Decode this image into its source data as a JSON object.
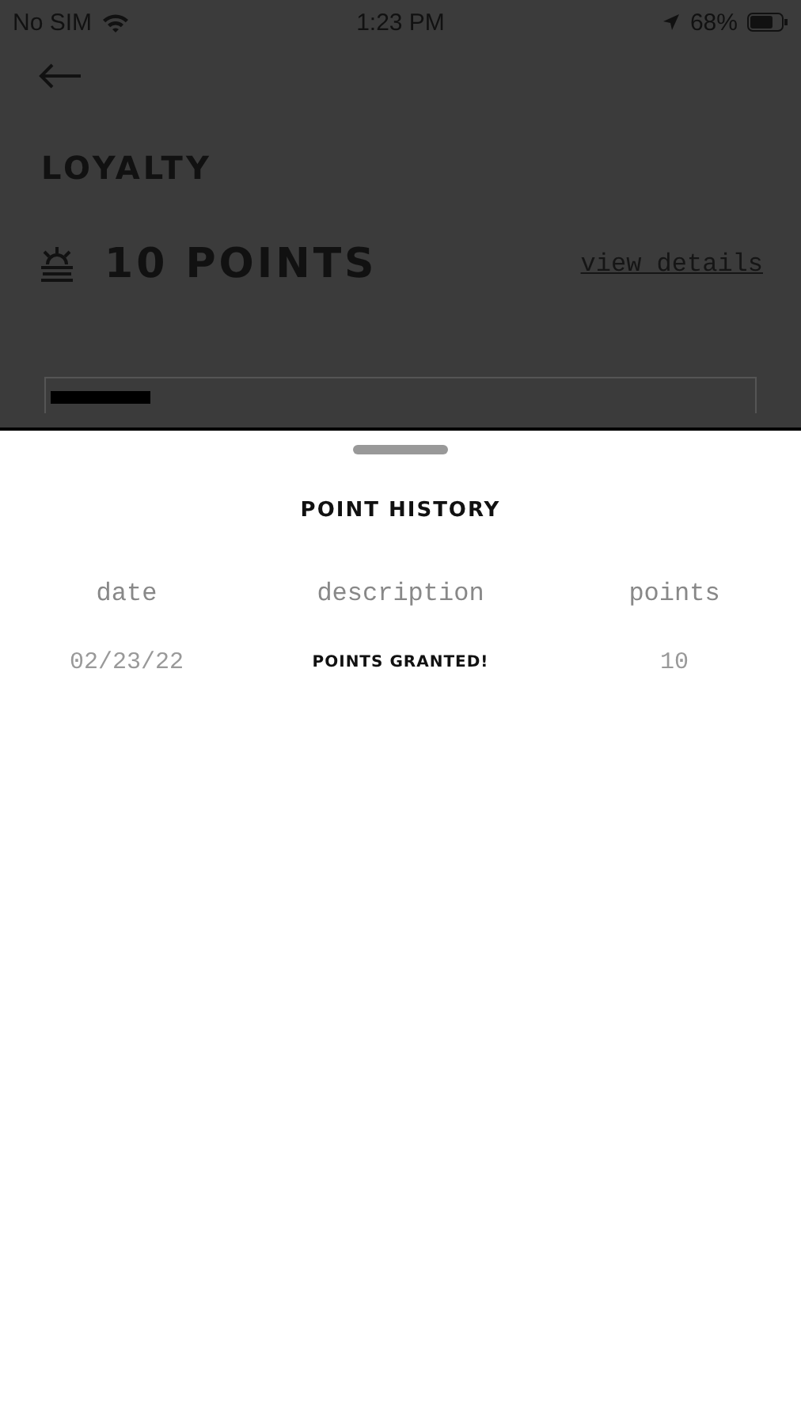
{
  "status_bar": {
    "carrier": "No SIM",
    "time": "1:23 PM",
    "battery": "68%"
  },
  "page": {
    "title": "LOYALTY",
    "points": "10 POINTS",
    "details_link": "view details",
    "progress": {
      "level": 0.14
    }
  },
  "sheet": {
    "title": "POINT HISTORY",
    "columns": [
      "date",
      "description",
      "points"
    ],
    "rows": [
      {
        "date": "02/23/22",
        "description": "POINTS GRANTED!",
        "points": "10"
      }
    ]
  }
}
